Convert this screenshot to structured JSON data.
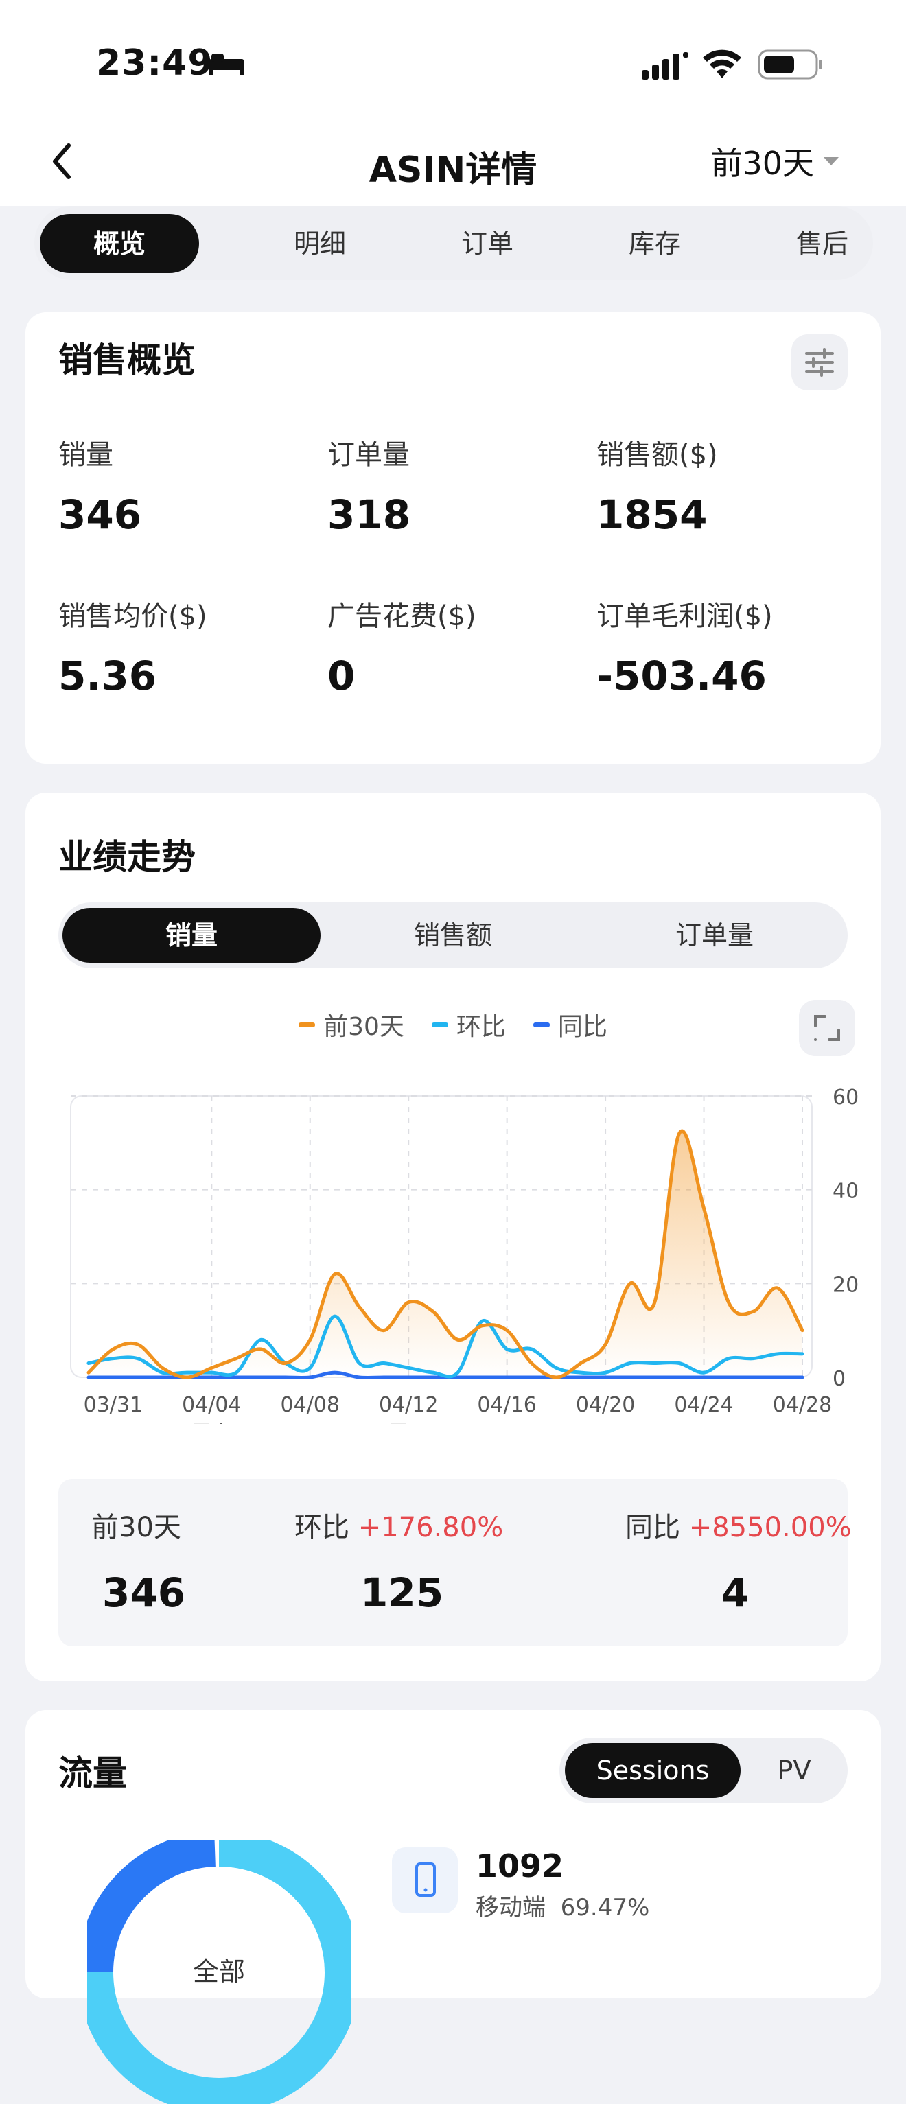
{
  "status_bar": {
    "time": "23:49"
  },
  "nav": {
    "title": "ASIN详情",
    "range": "前30天"
  },
  "tabs": [
    {
      "label": "概览"
    },
    {
      "label": "明细"
    },
    {
      "label": "订单"
    },
    {
      "label": "库存"
    },
    {
      "label": "售后"
    }
  ],
  "sales_overview": {
    "title": "销售概览",
    "metrics": [
      {
        "label": "销量",
        "value": "346"
      },
      {
        "label": "订单量",
        "value": "318"
      },
      {
        "label": "销售额($)",
        "value": "1854"
      },
      {
        "label": "销售均价($)",
        "value": "5.36"
      },
      {
        "label": "广告花费($)",
        "value": "0"
      },
      {
        "label": "订单毛利润($)",
        "value": "-503.46"
      }
    ]
  },
  "trend": {
    "title": "业绩走势",
    "segments": [
      "销量",
      "销售额",
      "订单量"
    ],
    "legend": [
      {
        "label": "前30天",
        "color": "#f0921e"
      },
      {
        "label": "环比",
        "color": "#22b5f0"
      },
      {
        "label": "同比",
        "color": "#2b6cf0"
      }
    ],
    "summary": {
      "current": {
        "label": "前30天",
        "value": "346"
      },
      "mom": {
        "label": "环比",
        "pct": "+176.80%",
        "value": "125"
      },
      "yoy": {
        "label": "同比",
        "pct": "+8550.00%",
        "value": "4"
      }
    }
  },
  "chart_data": {
    "type": "line",
    "ylim": [
      0,
      60
    ],
    "y_ticks": [
      60,
      40,
      20,
      0
    ],
    "x_ticks": [
      {
        "date": "03/31",
        "day": "二"
      },
      {
        "date": "04/04",
        "day": "周六"
      },
      {
        "date": "04/08",
        "day": "三"
      },
      {
        "date": "04/12",
        "day": "周日"
      },
      {
        "date": "04/16",
        "day": "四"
      },
      {
        "date": "04/20",
        "day": "一"
      },
      {
        "date": "04/24",
        "day": "五"
      },
      {
        "date": "04/28",
        "day": "二"
      }
    ],
    "x": [
      "03/30",
      "03/31",
      "04/01",
      "04/02",
      "04/03",
      "04/04",
      "04/05",
      "04/06",
      "04/07",
      "04/08",
      "04/09",
      "04/10",
      "04/11",
      "04/12",
      "04/13",
      "04/14",
      "04/15",
      "04/16",
      "04/17",
      "04/18",
      "04/19",
      "04/20",
      "04/21",
      "04/22",
      "04/23",
      "04/24",
      "04/25",
      "04/26",
      "04/27",
      "04/28"
    ],
    "series": [
      {
        "name": "前30天",
        "values": [
          1,
          6,
          7,
          2,
          0,
          2,
          4,
          6,
          3,
          8,
          22,
          15,
          10,
          16,
          14,
          8,
          11,
          10,
          3,
          0,
          3,
          7,
          20,
          16,
          52,
          36,
          16,
          14,
          19,
          10
        ]
      },
      {
        "name": "环比",
        "values": [
          3,
          4,
          4,
          1,
          1,
          1,
          1,
          8,
          3,
          2,
          13,
          3,
          3,
          2,
          1,
          1,
          12,
          6,
          6,
          2,
          1,
          1,
          3,
          3,
          3,
          1,
          4,
          4,
          5,
          5
        ]
      },
      {
        "name": "同比",
        "values": [
          0,
          0,
          0,
          0,
          0,
          0,
          0,
          0,
          0,
          0,
          1,
          0,
          0,
          0,
          0,
          0,
          0,
          0,
          0,
          0,
          0,
          0,
          0,
          0,
          0,
          0,
          0,
          0,
          0,
          0
        ]
      }
    ]
  },
  "traffic": {
    "title": "流量",
    "toggle": [
      "Sessions",
      "PV"
    ],
    "donut_label": "全部",
    "device": {
      "count": "1092",
      "label": "移动端",
      "pct": "69.47%"
    }
  }
}
